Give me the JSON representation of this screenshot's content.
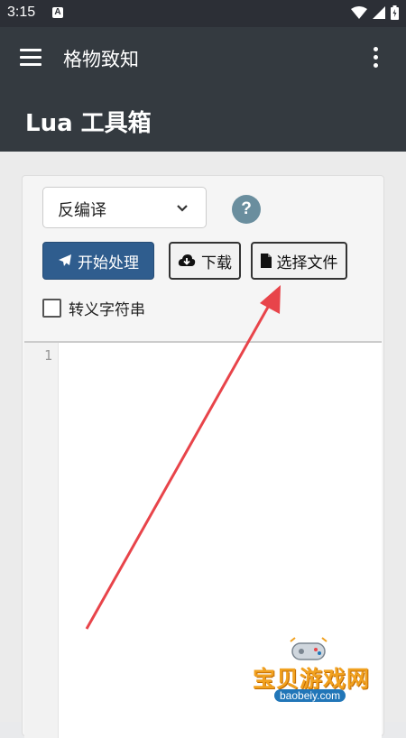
{
  "status_bar": {
    "time": "3:15",
    "notification_letter": "A"
  },
  "app_bar": {
    "title": "格物致知",
    "menu_icon": "menu-icon",
    "overflow_icon": "more-vert-icon"
  },
  "page": {
    "title": "Lua 工具箱"
  },
  "form": {
    "mode_select": {
      "selected": "反编译"
    },
    "help_label": "?",
    "start_button": "开始处理",
    "download_button": "下载",
    "choose_file_button": "选择文件",
    "escape_checkbox": {
      "label": "转义字符串",
      "checked": false
    }
  },
  "editor": {
    "line_numbers": [
      "1"
    ]
  },
  "annotation": {
    "arrow_color": "#e8444a"
  },
  "watermark": {
    "title": "宝贝游戏网",
    "url": "baobeiy.com"
  },
  "colors": {
    "primary": "#2f5d8e",
    "app_bar": "#343a40",
    "help": "#6a8e9e"
  }
}
